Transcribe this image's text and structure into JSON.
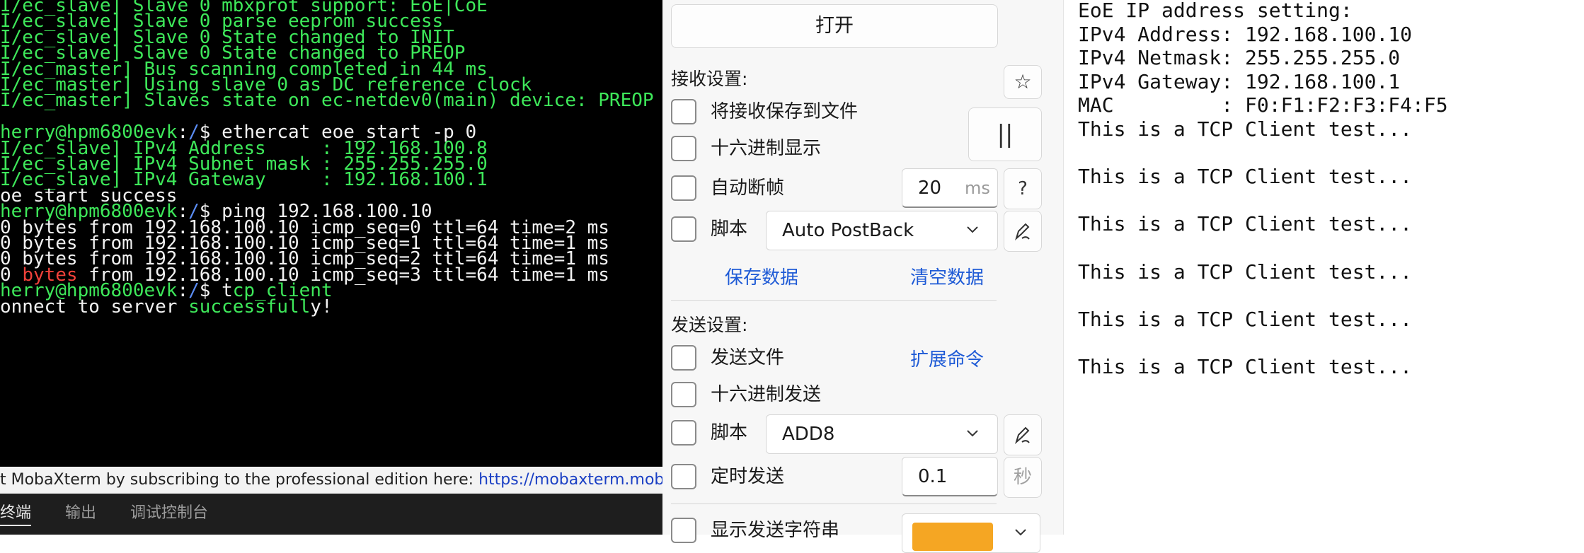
{
  "terminal": {
    "lines": [
      {
        "segments": [
          {
            "text": "I/ec_slave] Slave 0 mbxprot support: EoE|CoE",
            "color": "green"
          }
        ]
      },
      {
        "segments": [
          {
            "text": "I/ec_slave] Slave 0 parse eeprom success",
            "color": "green"
          }
        ]
      },
      {
        "segments": [
          {
            "text": "I/ec_slave] Slave 0 State changed to INIT",
            "color": "green"
          }
        ]
      },
      {
        "segments": [
          {
            "text": "I/ec_slave] Slave 0 State changed to PREOP",
            "color": "green"
          }
        ]
      },
      {
        "segments": [
          {
            "text": "I/ec_master] Bus scanning completed in 44 ms",
            "color": "green"
          }
        ]
      },
      {
        "segments": [
          {
            "text": "I/ec_master] Using slave 0 as DC reference clock",
            "color": "green"
          }
        ]
      },
      {
        "segments": [
          {
            "text": "I/ec_master] Slaves state on ec-netdev0(main) device: PREOP",
            "color": "green"
          }
        ]
      },
      {
        "segments": [
          {
            "text": "",
            "color": "green"
          }
        ]
      },
      {
        "segments": [
          {
            "text": "herry@hpm6800evk",
            "color": "green"
          },
          {
            "text": ":",
            "color": "white"
          },
          {
            "text": "/",
            "color": "blue"
          },
          {
            "text": "$ ethercat eoe_start -p 0",
            "color": "white"
          }
        ]
      },
      {
        "segments": [
          {
            "text": "I/ec_slave] IPv4 Address     : 192.168.100.8",
            "color": "green"
          }
        ]
      },
      {
        "segments": [
          {
            "text": "I/ec_slave] IPv4 Subnet mask : 255.255.255.0",
            "color": "green"
          }
        ]
      },
      {
        "segments": [
          {
            "text": "I/ec_slave] IPv4 Gateway     : 192.168.100.1",
            "color": "green"
          }
        ]
      },
      {
        "segments": [
          {
            "text": "oe start success",
            "color": "white"
          }
        ]
      },
      {
        "segments": [
          {
            "text": "herry@hpm6800evk",
            "color": "green"
          },
          {
            "text": ":",
            "color": "white"
          },
          {
            "text": "/",
            "color": "blue"
          },
          {
            "text": "$ ping 192.168.100.10",
            "color": "white"
          }
        ]
      },
      {
        "segments": [
          {
            "text": "0 bytes from 192.168.100.10 icmp_seq=0 ttl=64 time=2 ms",
            "color": "white"
          }
        ]
      },
      {
        "segments": [
          {
            "text": "0 bytes from 192.168.100.10 icmp_seq=1 ttl=64 time=1 ms",
            "color": "white"
          }
        ]
      },
      {
        "segments": [
          {
            "text": "0 bytes from 192.168.100.10 icmp_seq=2 ttl=64 time=1 ms",
            "color": "white"
          }
        ]
      },
      {
        "segments": [
          {
            "text": "0 ",
            "color": "white"
          },
          {
            "text": "bytes",
            "color": "red"
          },
          {
            "text": " from 192.168.100.10 icmp_seq=3 ttl=64 time=1 ms",
            "color": "white"
          }
        ]
      },
      {
        "segments": [
          {
            "text": "herry@hpm6800evk",
            "color": "green"
          },
          {
            "text": ":",
            "color": "white"
          },
          {
            "text": "/",
            "color": "blue"
          },
          {
            "text": "$ t",
            "color": "white"
          },
          {
            "text": "cp_client",
            "color": "green"
          }
        ]
      },
      {
        "segments": [
          {
            "text": "onnect to server ",
            "color": "white"
          },
          {
            "text": "successfull",
            "color": "green"
          },
          {
            "text": "y!",
            "color": "white"
          }
        ]
      },
      {
        "segments": [
          {
            "text": "",
            "color": "white"
          }
        ]
      }
    ],
    "promo_text": "t MobaXterm by subscribing to the professional edition here:  ",
    "promo_link": "https://mobaxterm.mobatek.net",
    "tabs": [
      "终端",
      "输出",
      "调试控制台"
    ]
  },
  "settings": {
    "open_button": "打开",
    "receive_title": "接收设置:",
    "star_icon": "☆",
    "save_to_file": "将接收保存到文件",
    "hex_display": "十六进制显示",
    "pause_icon": "||",
    "auto_break": "自动断帧",
    "auto_break_value": "20",
    "auto_break_unit": "ms",
    "help_icon": "?",
    "script_label": "脚本",
    "receive_script": "Auto PostBack",
    "save_data": "保存数据",
    "clear_data": "清空数据",
    "send_title": "发送设置:",
    "send_file": "发送文件",
    "extend_cmd": "扩展命令",
    "hex_send": "十六进制发送",
    "send_script": "ADD8",
    "timed_send": "定时发送",
    "timed_value": "0.1",
    "timed_unit": "秒",
    "show_send_string": "显示发送字符串",
    "accent_color": "#f5a623"
  },
  "output": {
    "lines": [
      "EoE IP address setting:",
      "IPv4 Address: 192.168.100.10",
      "IPv4 Netmask: 255.255.255.0",
      "IPv4 Gateway: 192.168.100.1",
      "MAC         : F0:F1:F2:F3:F4:F5",
      "This is a TCP Client test...",
      "",
      "This is a TCP Client test...",
      "",
      "This is a TCP Client test...",
      "",
      "This is a TCP Client test...",
      "",
      "This is a TCP Client test...",
      "",
      "This is a TCP Client test..."
    ]
  }
}
